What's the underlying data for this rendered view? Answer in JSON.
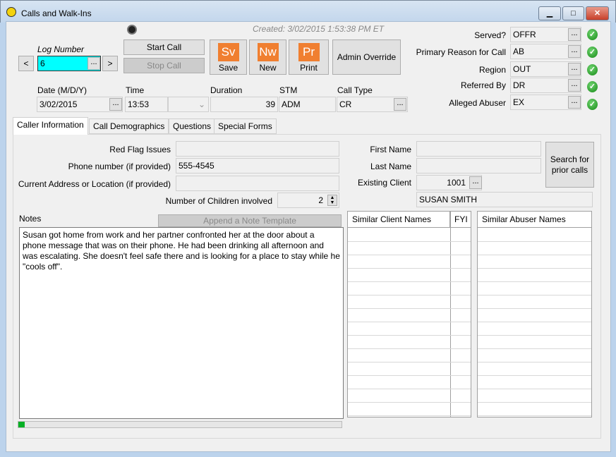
{
  "window": {
    "title": "Calls and Walk-Ins",
    "minimize": "▁",
    "maximize": "□",
    "close": "✕"
  },
  "header": {
    "created": "Created: 3/02/2015 1:53:38 PM ET",
    "log_number_label": "Log Number",
    "log_number": "6",
    "prev": "<",
    "next": ">",
    "ellipsis": "...",
    "start_call": "Start Call",
    "stop_call": "Stop Call",
    "save": {
      "icon": "Sv",
      "label": "Save"
    },
    "new": {
      "icon": "Nw",
      "label": "New"
    },
    "print": {
      "icon": "Pr",
      "label": "Print"
    },
    "admin_override": "Admin Override",
    "date_label": "Date (M/D/Y)",
    "date": "3/02/2015",
    "time_label": "Time",
    "time": "13:53",
    "duration_label": "Duration",
    "duration": "39",
    "stm_label": "STM",
    "stm": "ADM",
    "call_type_label": "Call Type",
    "call_type": "CR"
  },
  "codes": [
    {
      "label": "Served?",
      "value": "OFFR"
    },
    {
      "label": "Primary Reason for Call",
      "value": "AB"
    },
    {
      "label": "Region",
      "value": "OUT"
    },
    {
      "label": "Referred By",
      "value": "DR"
    },
    {
      "label": "Alleged Abuser",
      "value": "EX"
    }
  ],
  "tabs": [
    "Caller Information",
    "Call Demographics",
    "Questions",
    "Special Forms"
  ],
  "caller": {
    "red_flag_label": "Red Flag Issues",
    "red_flag": "",
    "phone_label": "Phone number (if provided)",
    "phone": "555-4545",
    "address_label": "Current Address or Location (if provided)",
    "address": "",
    "children_label": "Number of Children involved",
    "children": "2",
    "notes_label": "Notes",
    "append_template": "Append a Note Template",
    "notes": "Susan got home from work and her partner confronted her at the door about a phone message that was on their phone.  He had been drinking all afternoon and was escalating.  She doesn't feel safe there and is looking for a place to stay while he \"cools off\".",
    "first_name_label": "First Name",
    "first_name": "",
    "last_name_label": "Last Name",
    "last_name": "",
    "existing_client_label": "Existing Client",
    "existing_client": "1001",
    "client_name": "SUSAN SMITH",
    "search_prior": "Search for prior calls",
    "similar_clients_header": "Similar Client Names",
    "fyi_header": "FYI",
    "similar_abusers_header": "Similar Abuser Names"
  },
  "progress": {
    "percent": 2,
    "color": "#06b025"
  },
  "colors": {
    "log_number_bg": "#00ffff",
    "accent": "#f07f30"
  }
}
